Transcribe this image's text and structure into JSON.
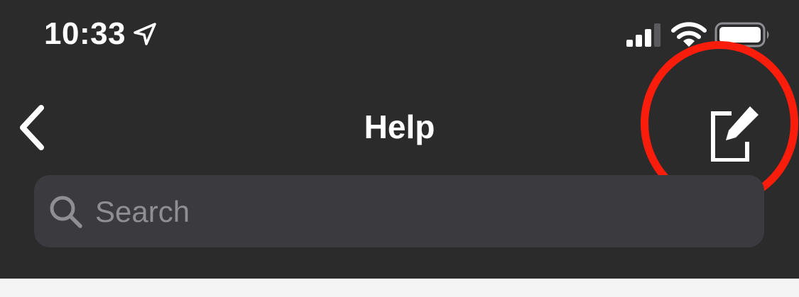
{
  "status_bar": {
    "time": "10:33",
    "location_icon": "location-arrow-icon",
    "signal_icon": "cellular-signal-icon",
    "wifi_icon": "wifi-icon",
    "battery_icon": "battery-icon"
  },
  "nav_bar": {
    "title": "Help",
    "back_icon": "chevron-left-icon",
    "compose_icon": "compose-icon"
  },
  "search": {
    "placeholder": "Search",
    "value": "",
    "icon": "magnifying-glass-icon"
  },
  "annotation": {
    "type": "circle",
    "color": "#fb1d0b"
  },
  "colors": {
    "background": "#2b2b2c",
    "search_field": "#3a3a3f",
    "placeholder_text": "#8e8e93",
    "foreground": "#ffffff"
  }
}
